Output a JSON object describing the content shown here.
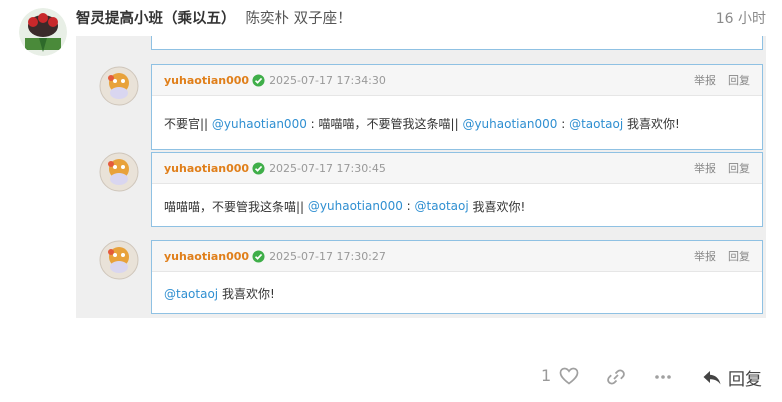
{
  "post": {
    "group": "智灵提高小班（乘以五）",
    "author": "陈奕朴 双子座！",
    "time": "16 小时"
  },
  "replies": [
    {
      "user": "yuhaotian000",
      "date": "2025-07-17 17:34:30",
      "report": "举报",
      "reply": "回复",
      "text1": "不要官||",
      "mention1": "@yuhaotian000",
      "text2": ": 喵喵喵，不要管我这条喵||",
      "mention2": "@yuhaotian000",
      "text3": ":",
      "mention3": "@taotaoj",
      "text4": "我喜欢你!"
    },
    {
      "user": "yuhaotian000",
      "date": "2025-07-17 17:30:45",
      "report": "举报",
      "reply": "回复",
      "text1": "喵喵喵，不要管我这条喵||",
      "mention1": "@yuhaotian000",
      "text2": ":",
      "mention2": "@taotaoj",
      "text3": "我喜欢你!"
    },
    {
      "user": "yuhaotian000",
      "date": "2025-07-17 17:30:27",
      "report": "举报",
      "reply": "回复",
      "mention1": "@taotaoj",
      "text1": "我喜欢你!"
    }
  ],
  "toolbar": {
    "like_count": "1",
    "reply_label": "回复"
  },
  "icons": {
    "like": "heart-icon",
    "link": "link-icon",
    "more": "more-icon",
    "reply": "reply-arrow-icon",
    "verified": "verified-check-icon"
  },
  "colors": {
    "username": "#e07f1a",
    "mention": "#2f8fd1",
    "box_border": "#8fc1e3",
    "verified": "#3fae49"
  }
}
